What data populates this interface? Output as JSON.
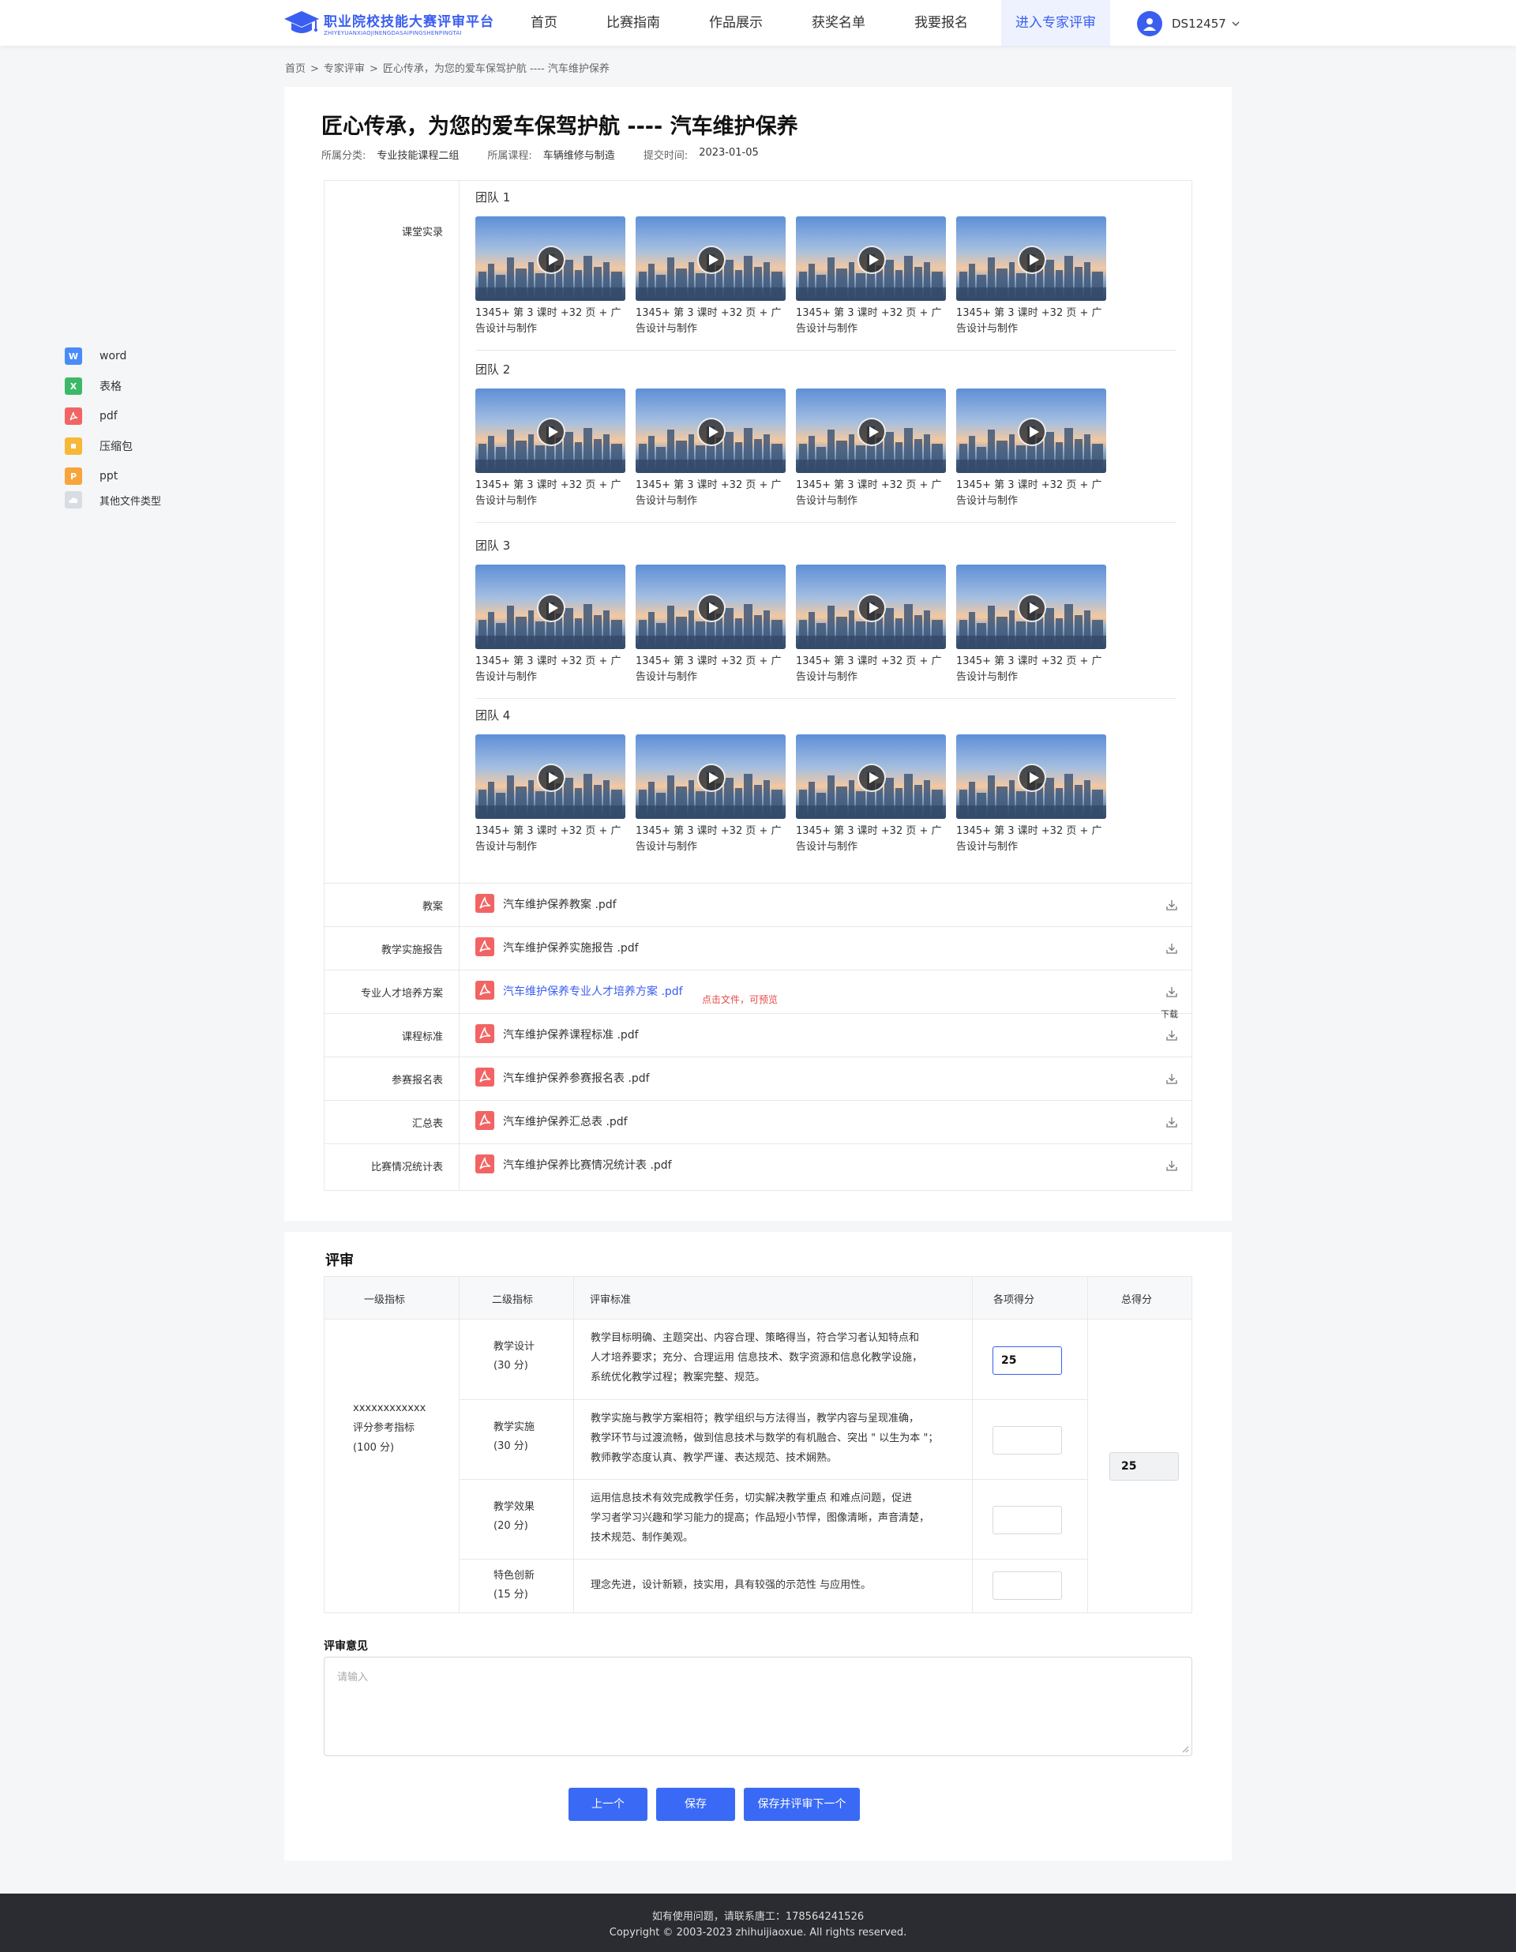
{
  "header": {
    "logo_cn": "职业院校技能大赛评审平台",
    "logo_en": "ZHIYEYUANXIAOJINENGDASAIPINGSHENPINGTAI",
    "nav": [
      "首页",
      "比赛指南",
      "作品展示",
      "获奖名单",
      "我要报名",
      "进入专家评审"
    ],
    "active_nav": "进入专家评审",
    "user_name": "DS12457"
  },
  "breadcrumb": [
    "首页",
    "专家评审",
    "匠心传承，为您的爱车保驾护航 ---- 汽车维护保养"
  ],
  "work": {
    "title": "匠心传承，为您的爱车保驾护航 ---- 汽车维护保养",
    "category_label": "所属分类:",
    "category": "专业技能课程二组",
    "course_label": "所属课程:",
    "course": "车辆维修与制造",
    "time_label": "提交时间:",
    "time": "2023-01-05"
  },
  "record": {
    "label": "课堂实录",
    "teams": [
      {
        "name": "团队 1",
        "videos": [
          "1345+ 第 3 课时 +32 页 + 广告设计与制作",
          "1345+ 第 3 课时 +32 页 + 广告设计与制作",
          "1345+ 第 3 课时 +32 页 + 广告设计与制作",
          "1345+ 第 3 课时 +32 页 + 广告设计与制作"
        ]
      },
      {
        "name": "团队 2",
        "videos": [
          "1345+ 第 3 课时 +32 页 + 广告设计与制作",
          "1345+ 第 3 课时 +32 页 + 广告设计与制作",
          "1345+ 第 3 课时 +32 页 + 广告设计与制作",
          "1345+ 第 3 课时 +32 页 + 广告设计与制作"
        ]
      },
      {
        "name": "团队 3",
        "videos": [
          "1345+ 第 3 课时 +32 页 + 广告设计与制作",
          "1345+ 第 3 课时 +32 页 + 广告设计与制作",
          "1345+ 第 3 课时 +32 页 + 广告设计与制作",
          "1345+ 第 3 课时 +32 页 + 广告设计与制作"
        ]
      },
      {
        "name": "团队 4",
        "videos": [
          "1345+ 第 3 课时 +32 页 + 广告设计与制作",
          "1345+ 第 3 课时 +32 页 + 广告设计与制作",
          "1345+ 第 3 课时 +32 页 + 广告设计与制作",
          "1345+ 第 3 课时 +32 页 + 广告设计与制作"
        ]
      }
    ]
  },
  "files": [
    {
      "label": "教案",
      "file": "汽车维护保养教案 .pdf"
    },
    {
      "label": "教学实施报告",
      "file": "汽车维护保养实施报告 .pdf"
    },
    {
      "label": "专业人才培养方案",
      "file": "汽车维护保养专业人才培养方案 .pdf"
    },
    {
      "label": "课程标准",
      "file": "汽车维护保养课程标准 .pdf"
    },
    {
      "label": "参赛报名表",
      "file": "汽车维护保养参赛报名表 .pdf"
    },
    {
      "label": "汇总表",
      "file": "汽车维护保养汇总表 .pdf"
    },
    {
      "label": "比赛情况统计表",
      "file": "汽车维护保养比赛情况统计表 .pdf"
    }
  ],
  "preview_tip": "点击文件，可预览",
  "download_tip": "下载",
  "legend": [
    {
      "label": "word",
      "icon": "word-icon",
      "color": "#4a8cf7"
    },
    {
      "label": "表格",
      "icon": "excel-icon",
      "color": "#3cb968"
    },
    {
      "label": "pdf",
      "icon": "pdf-icon",
      "color": "#f26464"
    },
    {
      "label": "压缩包",
      "icon": "zip-icon",
      "color": "#f7b83a"
    },
    {
      "label": "ppt",
      "icon": "ppt-icon",
      "color": "#f7a53a"
    },
    {
      "label": "其他文件类型",
      "icon": "other-file-icon",
      "color": "#d9dce2"
    }
  ],
  "review": {
    "title": "评审",
    "headers": [
      "一级指标",
      "二级指标",
      "评审标准",
      "各项得分",
      "总得分"
    ],
    "level1": [
      "xxxxxxxxxxxx",
      "评分参考指标",
      "(100 分)"
    ],
    "rows": [
      {
        "name": "教学设计",
        "points": "(30 分)",
        "criteria": [
          "教学目标明确、主题突出、内容合理、策略得当，符合学习者认知特点和",
          "人才培养要求；充分、合理运用 信息技术、数字资源和信息化教学设施，",
          "系统优化教学过程；教案完整、规范。"
        ],
        "score": "25"
      },
      {
        "name": "教学实施",
        "points": "(30 分)",
        "criteria": [
          "教学实施与教学方案相符；教学组织与方法得当，教学内容与呈现准确，",
          "教学环节与过渡流畅，做到信息技术与数学的有机融合、突出 \" 以生为本 \"；",
          "教师教学态度认真、教学严谨、表达规范、技术娴熟。"
        ],
        "score": ""
      },
      {
        "name": "教学效果",
        "points": "(20 分)",
        "criteria": [
          "运用信息技术有效完成教学任务，切实解决教学重点 和难点问题，促进",
          "学习者学习兴趣和学习能力的提高；作品短小节悍，图像清晰，声音清楚，",
          "技术规范、制作美观。"
        ],
        "score": ""
      },
      {
        "name": "特色创新",
        "points": "(15 分)",
        "criteria": [
          "理念先进，设计新颖，技实用，具有较强的示范性 与应用性。"
        ],
        "score": ""
      }
    ],
    "total": "25",
    "opinion_label": "评审意见",
    "opinion_placeholder": "请输入",
    "buttons": [
      "上一个",
      "保存",
      "保存并评审下一个"
    ]
  },
  "footer": {
    "contact": "如有使用问题，请联系唐工：178564241526",
    "copyright": "Copyright © 2003-2023 zhihuijiaoxue. All rights reserved."
  },
  "colors": {
    "accent": "#3a5ef0",
    "button": "#3a6af5",
    "footer_bg": "#2a2c31",
    "pdf": "#f26464",
    "tip": "#e84a4a"
  }
}
